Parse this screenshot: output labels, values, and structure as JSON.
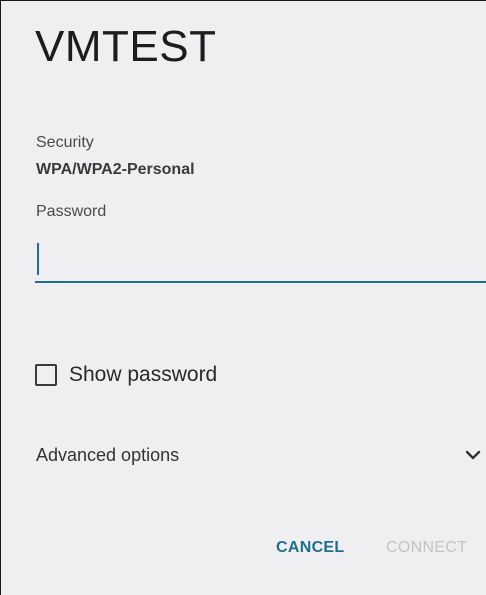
{
  "dialog": {
    "title": "VMTEST",
    "security_label": "Security",
    "security_value": "WPA/WPA2-Personal",
    "password_label": "Password",
    "password_value": "",
    "show_password_label": "Show password",
    "show_password_checked": false,
    "advanced_options_label": "Advanced options",
    "cancel_label": "CANCEL",
    "connect_label": "CONNECT"
  },
  "colors": {
    "accent": "#1d6f8e",
    "disabled": "#c4c4c6",
    "background": "#efeff1"
  },
  "icons": {
    "advanced_toggle": "chevron-down-icon"
  }
}
